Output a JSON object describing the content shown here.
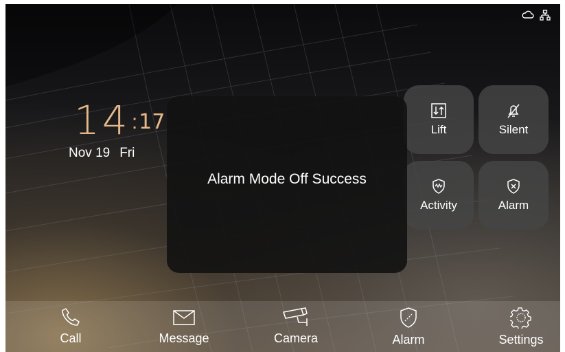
{
  "clock": {
    "hour": "14",
    "separator": ":",
    "minute": "17"
  },
  "date": {
    "day": "Nov 19",
    "weekday": "Fri"
  },
  "toast": {
    "message": "Alarm Mode Off Success"
  },
  "quick_actions": [
    {
      "label": "Lift",
      "icon": "lift-icon"
    },
    {
      "label": "Silent",
      "icon": "bell-off-icon"
    },
    {
      "label": "Activity",
      "icon": "shield-activity-icon"
    },
    {
      "label": "Alarm",
      "icon": "shield-x-icon"
    }
  ],
  "nav": [
    {
      "label": "Call",
      "icon": "phone-icon"
    },
    {
      "label": "Message",
      "icon": "envelope-icon"
    },
    {
      "label": "Camera",
      "icon": "cctv-icon"
    },
    {
      "label": "Alarm",
      "icon": "shield-icon"
    },
    {
      "label": "Settings",
      "icon": "gear-icon"
    }
  ],
  "status_icons": [
    "cloud-icon",
    "network-icon"
  ],
  "colors": {
    "clock": "#e6b98a",
    "button_bg": "#464646",
    "toast_bg": "#121212"
  }
}
